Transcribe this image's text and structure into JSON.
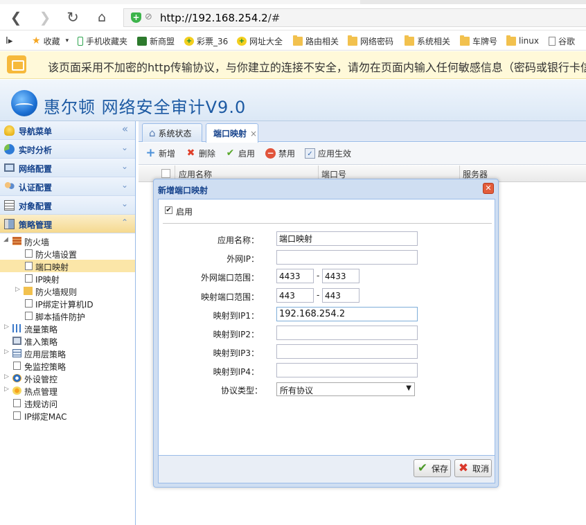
{
  "browser": {
    "url_host": "http://192.168.254.2",
    "url_path": "/#",
    "bookmarks": [
      {
        "label": "收藏",
        "icon": "star-icon"
      },
      {
        "label": "手机收藏夹",
        "icon": "phone-icon"
      },
      {
        "label": "新商盟",
        "icon": "leaf-icon"
      },
      {
        "label": "彩票_36",
        "icon": "globe-icon"
      },
      {
        "label": "网址大全",
        "icon": "globe-icon"
      },
      {
        "label": "路由相关",
        "icon": "folder-icon"
      },
      {
        "label": "网络密码",
        "icon": "folder-icon"
      },
      {
        "label": "系统相关",
        "icon": "folder-icon"
      },
      {
        "label": "车牌号",
        "icon": "folder-icon"
      },
      {
        "label": "linux",
        "icon": "folder-icon"
      },
      {
        "label": "谷歌",
        "icon": "page-icon"
      }
    ],
    "warning": "该页面采用不加密的http传输协议，与你建立的连接不安全，请勿在页面内输入任何敏感信息（密码或银行卡信息"
  },
  "app": {
    "title": "惠尔顿 网络安全审计V9.0"
  },
  "sidebar": {
    "sections": [
      {
        "label": "导航菜单",
        "icon": "bulb-icon",
        "chevron": "«"
      },
      {
        "label": "实时分析",
        "icon": "pie-chart-icon",
        "chevron": "⌄"
      },
      {
        "label": "网络配置",
        "icon": "monitor-icon",
        "chevron": "⌄"
      },
      {
        "label": "认证配置",
        "icon": "users-icon",
        "chevron": "⌄"
      },
      {
        "label": "对象配置",
        "icon": "list-icon",
        "chevron": "⌄"
      },
      {
        "label": "策略管理",
        "icon": "policy-icon",
        "chevron": "⌃"
      }
    ],
    "tree": [
      {
        "label": "防火墙",
        "level": 0,
        "toggle": "◢",
        "icon": "firewall-icon"
      },
      {
        "label": "防火墙设置",
        "level": 1,
        "toggle": "",
        "icon": "doc-icon"
      },
      {
        "label": "端口映射",
        "level": 1,
        "toggle": "",
        "icon": "doc-icon",
        "selected": true
      },
      {
        "label": "IP映射",
        "level": 1,
        "toggle": "",
        "icon": "doc-icon"
      },
      {
        "label": "防火墙规则",
        "level": 1,
        "toggle": "▷",
        "icon": "folder-icon"
      },
      {
        "label": "IP绑定计算机ID",
        "level": 1,
        "toggle": "",
        "icon": "doc-icon"
      },
      {
        "label": "脚本插件防护",
        "level": 1,
        "toggle": "",
        "icon": "doc-icon"
      },
      {
        "label": "流量策略",
        "level": 0,
        "toggle": "▷",
        "icon": "flow-icon"
      },
      {
        "label": "准入策略",
        "level": 0,
        "toggle": "",
        "icon": "access-icon"
      },
      {
        "label": "应用层策略",
        "level": 0,
        "toggle": "▷",
        "icon": "app-layer-icon"
      },
      {
        "label": "免监控策略",
        "level": 0,
        "toggle": "",
        "icon": "doc-icon"
      },
      {
        "label": "外设管控",
        "level": 0,
        "toggle": "▷",
        "icon": "gear-icon"
      },
      {
        "label": "热点管理",
        "level": 0,
        "toggle": "▷",
        "icon": "hotspot-icon"
      },
      {
        "label": "违规访问",
        "level": 0,
        "toggle": "",
        "icon": "doc-icon"
      },
      {
        "label": "IP绑定MAC",
        "level": 0,
        "toggle": "",
        "icon": "doc-icon"
      }
    ]
  },
  "tabs": [
    {
      "label": "系统状态",
      "icon": "home-icon"
    },
    {
      "label": "端口映射",
      "close": "×"
    }
  ],
  "toolbar": {
    "add": "新增",
    "delete": "删除",
    "enable": "启用",
    "disable": "禁用",
    "apply": "应用生效"
  },
  "grid": {
    "columns": [
      "应用名称",
      "端口号",
      "服务器"
    ]
  },
  "dialog": {
    "title": "新增端口映射",
    "close": "✕",
    "enable_label": "启用",
    "enable_checked": "✔",
    "fields": {
      "app_name_label": "应用名称：",
      "app_name_value": "端口映射",
      "wan_ip_label": "外网IP：",
      "wan_ip_value": "",
      "wan_port_label": "外网端口范围：",
      "wan_port_from": "4433",
      "wan_port_to": "4433",
      "map_port_label": "映射端口范围：",
      "map_port_from": "443",
      "map_port_to": "443",
      "ip1_label": "映射到IP1：",
      "ip1_value": "192.168.254.2",
      "ip2_label": "映射到IP2：",
      "ip2_value": "",
      "ip3_label": "映射到IP3：",
      "ip3_value": "",
      "ip4_label": "映射到IP4：",
      "ip4_value": "",
      "proto_label": "协议类型：",
      "proto_value": "所有协议",
      "range_dash": "-"
    },
    "save": "保存",
    "cancel": "取消"
  }
}
